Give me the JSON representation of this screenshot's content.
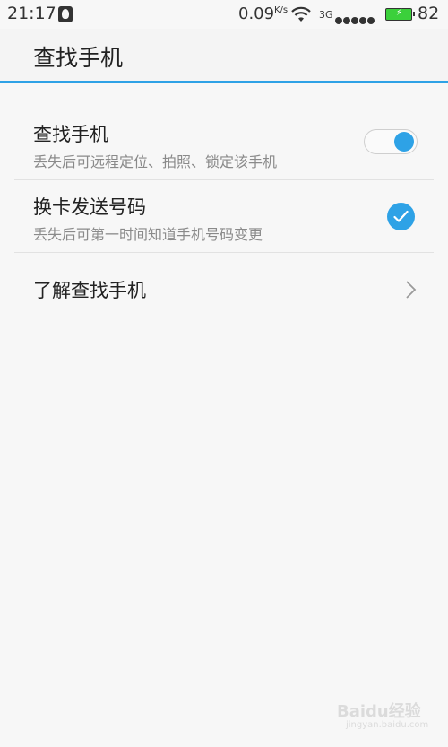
{
  "status_bar": {
    "time": "21:17",
    "net_speed": "0.09",
    "net_speed_unit": "K/s",
    "network_type": "3G",
    "signal_dots": 5,
    "battery_level": "82",
    "icons": [
      "qq-icon",
      "wifi-icon",
      "signal-icon",
      "battery-icon"
    ]
  },
  "header": {
    "title": "查找手机"
  },
  "settings": {
    "items": [
      {
        "title": "查找手机",
        "subtitle": "丢失后可远程定位、拍照、锁定该手机",
        "control": "toggle",
        "on": true
      },
      {
        "title": "换卡发送号码",
        "subtitle": "丢失后可第一时间知道手机号码变更",
        "control": "checkbox",
        "checked": true
      },
      {
        "title": "了解查找手机",
        "control": "chevron"
      }
    ]
  },
  "watermark": {
    "brand": "Baidu经验",
    "url": "jingyan.baidu.com"
  },
  "colors": {
    "accent": "#2ea2e6",
    "background": "#f7f7f7",
    "battery": "#3bd03b"
  }
}
